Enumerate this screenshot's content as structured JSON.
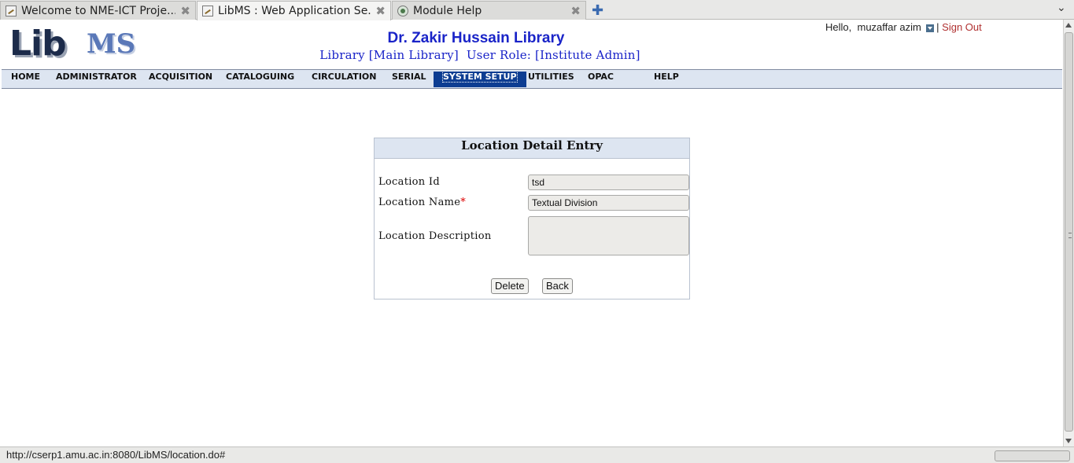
{
  "browser": {
    "tabs": [
      {
        "title": "Welcome to NME-ICT Proje...",
        "active": false,
        "icon": "page-icon"
      },
      {
        "title": "LibMS : Web Application Se...",
        "active": true,
        "icon": "page-icon"
      },
      {
        "title": "Module Help",
        "active": false,
        "icon": "globe-icon"
      }
    ],
    "close_glyph": "✖",
    "newtab_glyph": "✚",
    "menu_glyph": "⌄"
  },
  "header": {
    "logo_lib": "Lib",
    "logo_ms": "MS",
    "library_title": "Dr. Zakir Hussain Library",
    "library_info": "Library [Main Library]",
    "user_role": "User Role: [Institute Admin]",
    "greeting": "Hello,",
    "username": "muzaffar azim",
    "separator": "|",
    "signout": "Sign Out"
  },
  "menu": {
    "items": [
      "HOME",
      "ADMINISTRATOR",
      "ACQUISITION",
      "CATALOGUING",
      "CIRCULATION",
      "SERIAL",
      "SYSTEM SETUP",
      "UTILITIES",
      "OPAC",
      "HELP"
    ],
    "active": "SYSTEM SETUP"
  },
  "form": {
    "title": "Location Detail Entry",
    "location_id_label": "Location Id",
    "location_id_value": "tsd",
    "location_name_label": "Location Name",
    "required_mark": "*",
    "location_name_value": "Textual Division",
    "location_desc_label": "Location Description",
    "location_desc_value": "",
    "delete_label": "Delete",
    "back_label": "Back"
  },
  "status": {
    "url": "http://cserp1.amu.ac.in:8080/LibMS/location.do#"
  },
  "colors": {
    "title_blue": "#1a24c8",
    "menu_bg": "#dde5f1",
    "menu_active": "#0d3d92",
    "signout": "#b03030"
  }
}
